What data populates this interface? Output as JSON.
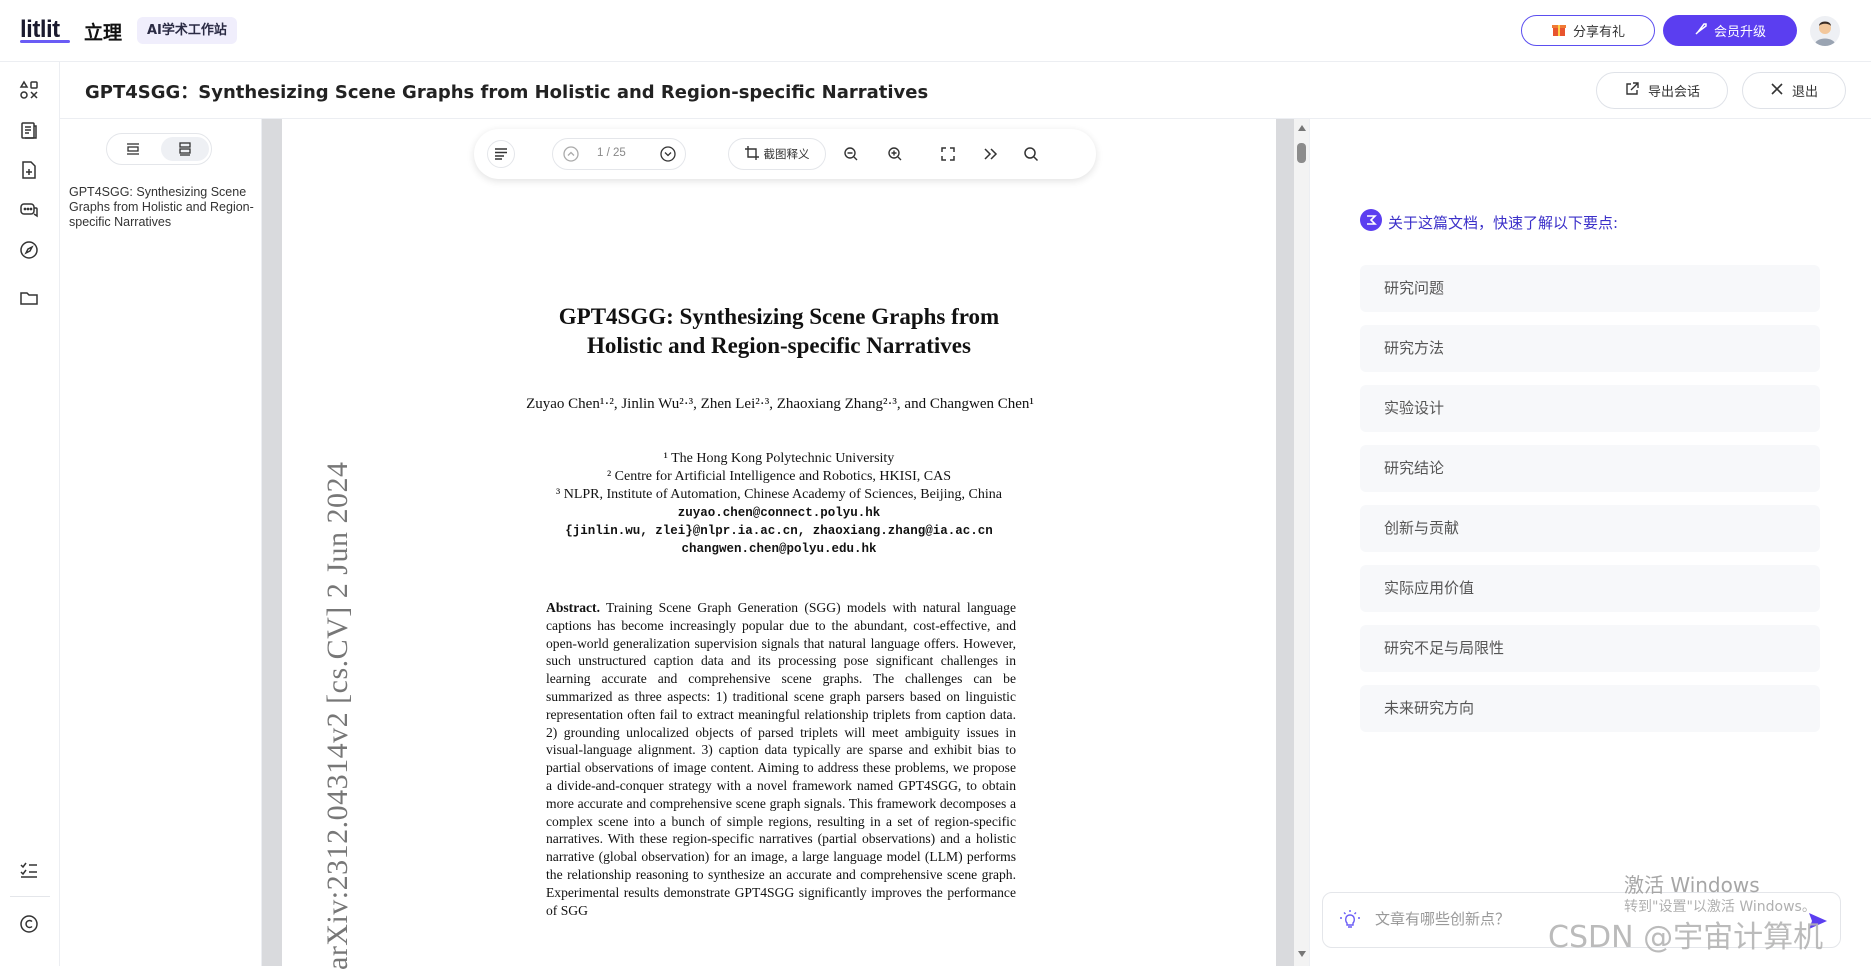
{
  "topbar": {
    "logo": "litlit",
    "brand_cn": "立理",
    "ai_badge": "AI学术工作站",
    "share_label": "分享有礼",
    "upgrade_label": "会员升级"
  },
  "doc": {
    "title": "GPT4SGG：Synthesizing Scene Graphs from Holistic and Region-specific Narratives",
    "export_label": "导出会话",
    "exit_label": "退出"
  },
  "outline": {
    "item": "GPT4SGG: Synthesizing Scene Graphs from Holistic and Region-specific Narratives"
  },
  "toolbar": {
    "page_indicator": "1 / 25",
    "ocr_label": "截图释义"
  },
  "paper": {
    "title_line1": "GPT4SGG: Synthesizing Scene Graphs from",
    "title_line2": "Holistic and Region-specific Narratives",
    "authors": "Zuyao Chen¹·², Jinlin Wu²·³, Zhen Lei²·³, Zhaoxiang Zhang²·³, and Changwen Chen¹",
    "aff1": "¹ The Hong Kong Polytechnic University",
    "aff2": "² Centre for Artificial Intelligence and Robotics, HKISI, CAS",
    "aff3": "³ NLPR, Institute of Automation, Chinese Academy of Sciences, Beijing, China",
    "email1": "zuyao.chen@connect.polyu.hk",
    "email2": "{jinlin.wu, zlei}@nlpr.ia.ac.cn, zhaoxiang.zhang@ia.ac.cn",
    "email3": "changwen.chen@polyu.edu.hk",
    "abstract_label": "Abstract.",
    "abstract_text": "Training Scene Graph Generation (SGG) models with natural language captions has become increasingly popular due to the abundant, cost-effective, and open-world generalization supervision signals that natural language offers. However, such unstructured caption data and its processing pose significant challenges in learning accurate and comprehensive scene graphs. The challenges can be summarized as three aspects: 1) traditional scene graph parsers based on linguistic representation often fail to extract meaningful relationship triplets from caption data. 2) grounding unlocalized objects of parsed triplets will meet ambiguity issues in visual-language alignment. 3) caption data typically are sparse and exhibit bias to partial observations of image content. Aiming to address these problems, we propose a divide-and-conquer strategy with a novel framework named GPT4SGG, to obtain more accurate and comprehensive scene graph signals. This framework decomposes a complex scene into a bunch of simple regions, resulting in a set of region-specific narratives. With these region-specific narratives (partial observations) and a holistic narrative (global observation) for an image, a large language model (LLM) performs the relationship reasoning to synthesize an accurate and comprehensive scene graph. Experimental results demonstrate GPT4SGG significantly improves the performance of SGG",
    "arxiv_stamp": "arXiv:2312.04314v2  [cs.CV]  2 Jun 2024"
  },
  "keypoints": {
    "heading": "关于这篇文档，快速了解以下要点:",
    "items": [
      "研究问题",
      "研究方法",
      "实验设计",
      "研究结论",
      "创新与贡献",
      "实际应用价值",
      "研究不足与局限性",
      "未来研究方向"
    ]
  },
  "chat": {
    "placeholder": "文章有哪些创新点？"
  },
  "watermark": {
    "line1": "激活 Windows",
    "line2": "转到\"设置\"以激活 Windows。",
    "line3": "CSDN @宇宙计算机"
  },
  "colors": {
    "accent": "#5b3ef0",
    "keypoint_text": "#3b30c9"
  }
}
